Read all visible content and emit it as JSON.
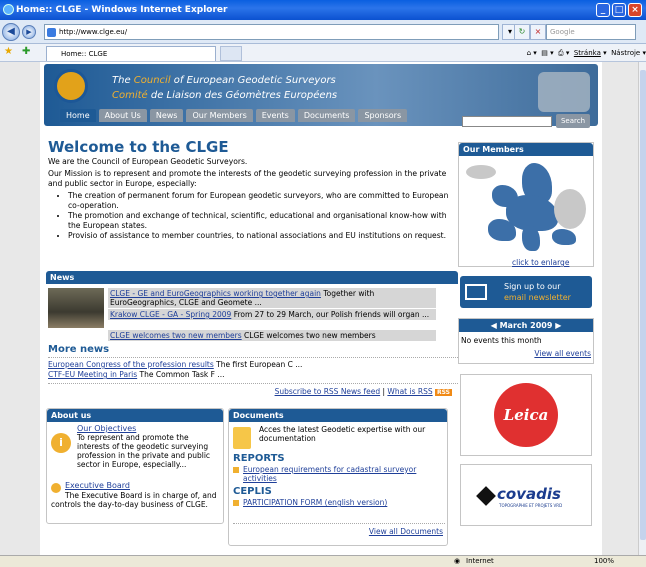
{
  "browser": {
    "title": "Home:: CLGE - Windows Internet Explorer",
    "address": "http://www.clge.eu/",
    "search_placeholder": "Google",
    "tab_title": "Home:: CLGE",
    "page_menu": "Stránka",
    "tools_menu": "Nástroje",
    "status_zone": "Internet",
    "zoom": "100%"
  },
  "header": {
    "line1_pre": "The ",
    "line1_hl": "Council",
    "line1_post": " of European Geodetic Surveyors",
    "line2_hl": "Comité",
    "line2_post": " de Liaison des Géomètres Européens",
    "search_button": "Search"
  },
  "nav": [
    "Home",
    "About Us",
    "News",
    "Our Members",
    "Events",
    "Documents",
    "Sponsors"
  ],
  "welcome": {
    "title": "Welcome to the CLGE",
    "p1": "We are the Council of European Geodetic Surveyors.",
    "p2": "Our Mission is to represent and promote the interests of the geodetic surveying profession in the private and public sector in Europe, especially:",
    "bullets": [
      "The creation of permanent forum for European geodetic surveyors, who are committed to European co-operation.",
      "The promotion and exchange of technical, scientific, educational and organisational know-how with the European states.",
      "Provisio of assistance to member countries, to national associations and EU institutions on request."
    ]
  },
  "news": {
    "header": "News",
    "items": [
      {
        "link": "CLGE - GE and EuroGeographics working together again",
        "text": " Together with EuroGeographics, CLGE and Geomete ..."
      },
      {
        "link": "Krakow CLGE - GA - Spring 2009",
        "text": " From 27 to 29 March, our Polish friends will organ ..."
      },
      {
        "link": "CLGE welcomes two new members",
        "text": " CLGE welcomes two new members"
      }
    ],
    "more_title": "More news",
    "more": [
      {
        "link": "European Congress of the profession results",
        "text": " The first European C ..."
      },
      {
        "link": "CTF-EU Meeting in Paris",
        "text": " The Common Task F ..."
      }
    ],
    "rss_link": "Subscribe to RSS News feed",
    "rss_sep": " | ",
    "rss_what": "What is RSS",
    "rss_badge": "RSS"
  },
  "about": {
    "header": "About us",
    "obj_link": "Our Objectives",
    "obj_text": "To represent and promote the interests of the geodetic surveying profession in the private and public sector in Europe, especially...",
    "eb_link": "Executive Board",
    "eb_text": "The Executive Board is in charge of, and controls the day-to-day business of CLGE."
  },
  "documents": {
    "header": "Documents",
    "intro": "Acces the latest Geodetic expertise with our documentation",
    "reports": "REPORTS",
    "report_link": "European requirements for cadastral surveyor activities",
    "ceplis": "CEPLIS",
    "ceplis_link": "PARTICIPATION FORM (english version)",
    "view_all": "View all Documents"
  },
  "members": {
    "header": "Our Members",
    "enlarge": "click to enlarge"
  },
  "signup": {
    "line1": "Sign up to our",
    "line2": "email newsletter"
  },
  "calendar": {
    "month": "March 2009",
    "empty": "No events this month",
    "view_all": "View all events"
  },
  "sponsors": {
    "leica": "Leica",
    "covadis": "covadis",
    "covadis_sub": "TOPOGRAPHIE ET PROJETS VRD"
  }
}
